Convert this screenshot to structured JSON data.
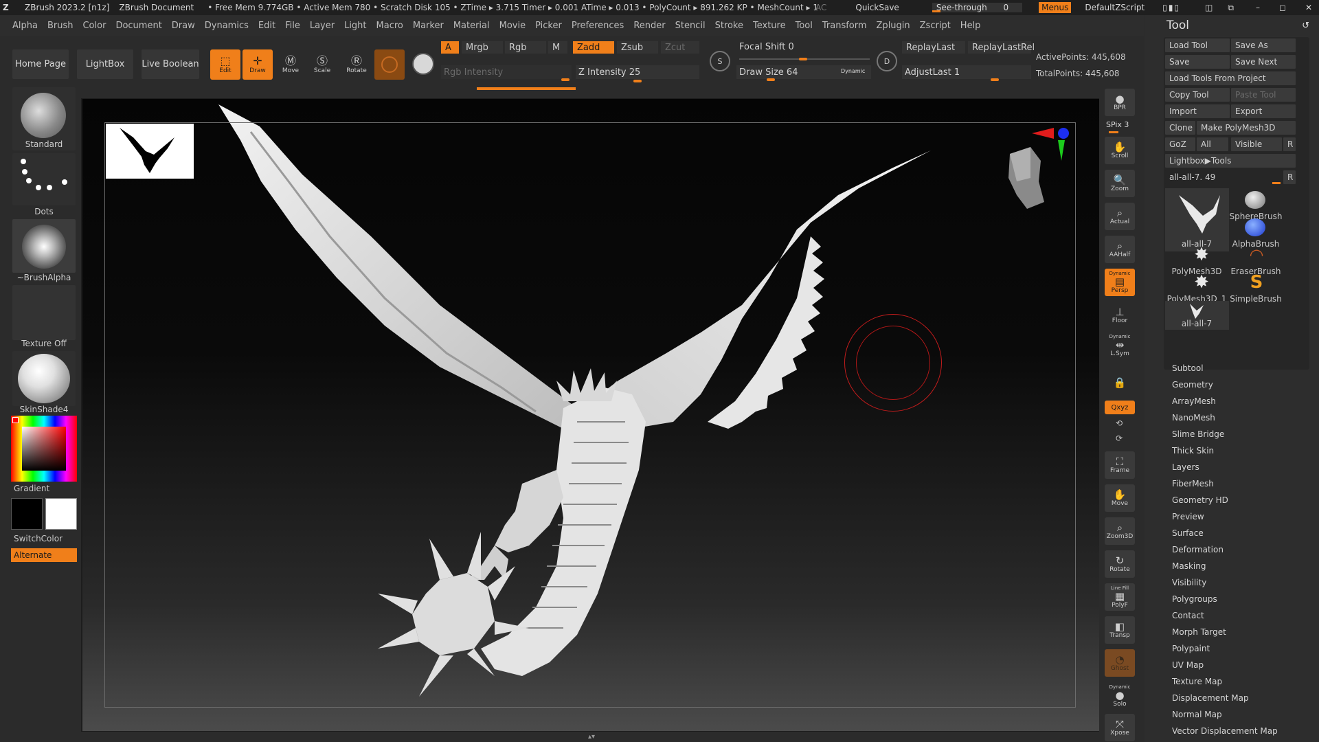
{
  "titlebar": {
    "app": "ZBrush 2023.2 [n1z]",
    "doc": "ZBrush Document",
    "stats": "• Free Mem 9.774GB • Active Mem 780 • Scratch Disk 105 • ZTime ▸ 3.715 Timer ▸ 0.001 ATime ▸ 0.013 • PolyCount ▸ 891.262 KP • MeshCount ▸ 1",
    "ac": "AC",
    "quicksave": "QuickSave",
    "seethrough": "See-through",
    "seethrough_value": "0",
    "menus": "Menus",
    "script": "DefaultZScript"
  },
  "menubar": [
    "Alpha",
    "Brush",
    "Color",
    "Document",
    "Draw",
    "Dynamics",
    "Edit",
    "File",
    "Layer",
    "Light",
    "Macro",
    "Marker",
    "Material",
    "Movie",
    "Picker",
    "Preferences",
    "Render",
    "Stencil",
    "Stroke",
    "Texture",
    "Tool",
    "Transform",
    "Zplugin",
    "Zscript",
    "Help"
  ],
  "topshelf": {
    "home_page": "Home Page",
    "lightbox": "LightBox",
    "live_boolean": "Live Boolean",
    "edit": "Edit",
    "draw": "Draw",
    "move": "Move",
    "scale": "Scale",
    "rotate": "Rotate",
    "a": "A",
    "mrgb": "Mrgb",
    "rgb": "Rgb",
    "m": "M",
    "rgb_intensity": "Rgb Intensity",
    "zadd": "Zadd",
    "zsub": "Zsub",
    "zcut": "Zcut",
    "z_intensity_label": "Z Intensity",
    "z_intensity": "25",
    "focal_shift_label": "Focal Shift",
    "focal_shift": "0",
    "draw_size_label": "Draw Size",
    "draw_size": "64",
    "dynamic": "Dynamic",
    "replay_last": "ReplayLast",
    "replay_last_rel": "ReplayLastRel",
    "adjust_last_label": "AdjustLast",
    "adjust_last": "1",
    "active_points": "ActivePoints: 445,608",
    "total_points": "TotalPoints: 445,608"
  },
  "leftshelf": {
    "brush": "Standard",
    "stroke": "Dots",
    "alpha": "~BrushAlpha",
    "texture": "Texture Off",
    "material": "SkinShade4",
    "gradient": "Gradient",
    "switchcolor": "SwitchColor",
    "alternate": "Alternate"
  },
  "rightshelf": {
    "bpr": "BPR",
    "spix": "SPix 3",
    "scroll": "Scroll",
    "zoom": "Zoom",
    "actual": "Actual",
    "aahalf": "AAHalf",
    "persp": "Persp",
    "floor": "Floor",
    "lsym": "L.Sym",
    "xyz": "Qxyz",
    "frame": "Frame",
    "move": "Move",
    "zoom3d": "Zoom3D",
    "rotate": "Rotate",
    "polyf": "PolyF",
    "line_fill": "Line Fill",
    "transp": "Transp",
    "ghost": "Ghost",
    "solo": "Solo",
    "xpose": "Xpose",
    "dynamic": "Dynamic"
  },
  "toolpanel": {
    "title": "Tool",
    "buttons": {
      "load_tool": "Load Tool",
      "save_as": "Save As",
      "save": "Save",
      "save_next": "Save Next",
      "load_from_project": "Load Tools From Project",
      "copy_tool": "Copy Tool",
      "paste_tool": "Paste Tool",
      "import": "Import",
      "export": "Export",
      "clone": "Clone",
      "make_polymesh": "Make PolyMesh3D",
      "goz": "GoZ",
      "all": "All",
      "visible": "Visible",
      "r": "R",
      "lightbox_tools": "Lightbox▶Tools",
      "current_tool": "all-all-7. 49"
    },
    "tools": [
      "all-all-7",
      "SphereBrush",
      "AlphaBrush",
      "PolyMesh3D",
      "EraserBrush",
      "PolyMesh3D_1",
      "SimpleBrush",
      "all-all-7"
    ],
    "subpalettes": [
      "Subtool",
      "Geometry",
      "ArrayMesh",
      "NanoMesh",
      "Slime Bridge",
      "Thick Skin",
      "Layers",
      "FiberMesh",
      "Geometry HD",
      "Preview",
      "Surface",
      "Deformation",
      "Masking",
      "Visibility",
      "Polygroups",
      "Contact",
      "Morph Target",
      "Polypaint",
      "UV Map",
      "Texture Map",
      "Displacement Map",
      "Normal Map",
      "Vector Displacement Map"
    ]
  },
  "colors": {
    "accent": "#f07f1a",
    "panel": "#2b2b2b",
    "primary_color": "#000000",
    "secondary_color": "#ffffff"
  }
}
